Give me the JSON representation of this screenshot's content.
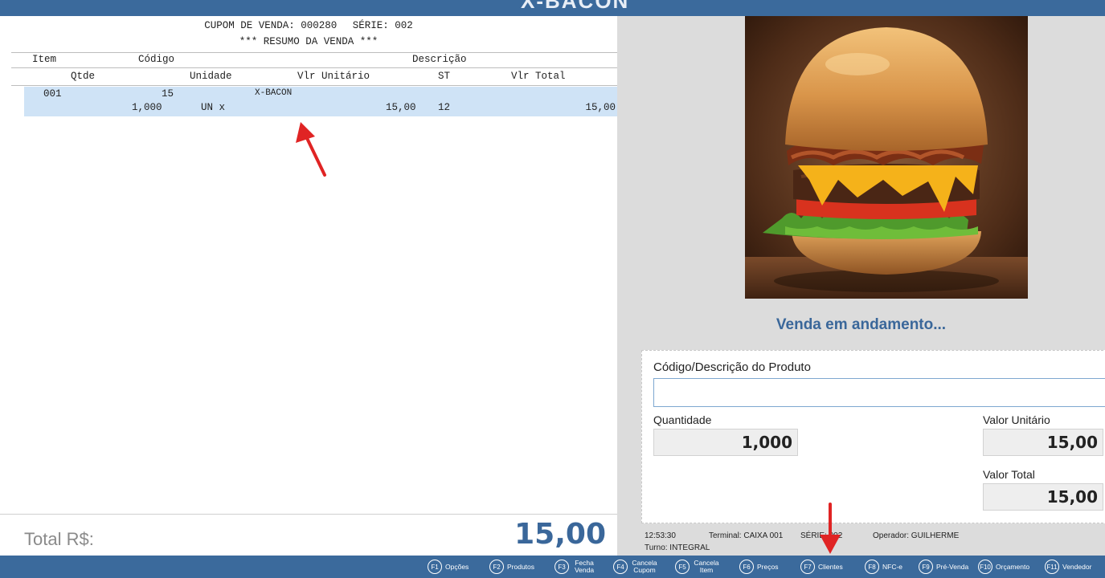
{
  "window": {
    "title": "X-BACON"
  },
  "receipt": {
    "coupon_label": "CUPOM DE VENDA: 000280",
    "series_label": "SÉRIE: 002",
    "summary_title": "*** RESUMO DA VENDA ***",
    "columns_row1": [
      "Item",
      "Código",
      "Descrição"
    ],
    "columns_row2": [
      "Qtde",
      "Unidade",
      "Vlr Unitário",
      "ST",
      "Vlr Total"
    ],
    "items": [
      {
        "item": "001",
        "code": "15",
        "description": "X-BACON",
        "qty": "1,000",
        "unit": "UN x",
        "unit_price": "15,00",
        "st": "12",
        "total": "15,00"
      }
    ]
  },
  "total": {
    "label": "Total R$:",
    "value": "15,00"
  },
  "right": {
    "image_icon": "burger-image",
    "status": "Venda em andamento...",
    "product_field_label": "Código/Descrição do Produto",
    "product_field_value": "",
    "quantity_label": "Quantidade",
    "quantity_value": "1,000",
    "unit_value_label": "Valor Unitário",
    "unit_value": "15,00",
    "total_value_label": "Valor Total",
    "total_value": "15,00"
  },
  "info": {
    "time": "12:53:30",
    "terminal": "Terminal: CAIXA 001",
    "series": "SÉRIE: 002",
    "operator": "Operador: GUILHERME",
    "shift": "Turno: INTEGRAL"
  },
  "fkeys": [
    {
      "key": "F1",
      "label": "Opções"
    },
    {
      "key": "F2",
      "label": "Produtos"
    },
    {
      "key": "F3",
      "label": "Fecha Venda"
    },
    {
      "key": "F4",
      "label": "Cancela Cupom"
    },
    {
      "key": "F5",
      "label": "Cancela Item"
    },
    {
      "key": "F6",
      "label": "Preços"
    },
    {
      "key": "F7",
      "label": "Clientes"
    },
    {
      "key": "F8",
      "label": "NFC-e"
    },
    {
      "key": "F9",
      "label": "Pré-Venda"
    },
    {
      "key": "F10",
      "label": "Orçamento"
    },
    {
      "key": "F11",
      "label": "Vendedor"
    }
  ],
  "colors": {
    "accent": "#3a679a",
    "bar": "#3b6a9c",
    "selection": "#cfe3f6",
    "panel": "#dcdcdc"
  }
}
